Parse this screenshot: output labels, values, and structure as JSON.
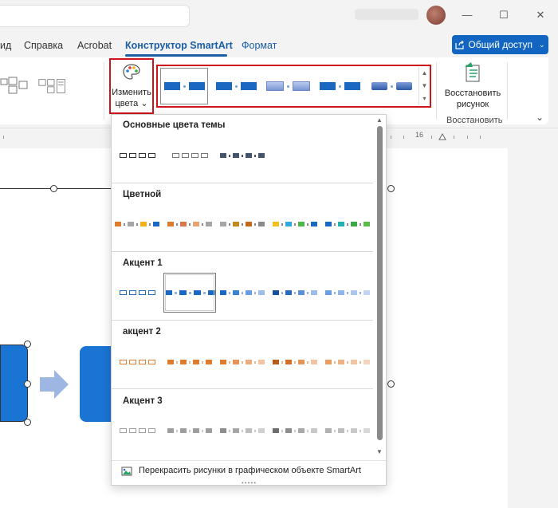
{
  "titlebar": {
    "controls": [
      "—",
      "☐",
      "✕"
    ]
  },
  "tabs": [
    {
      "label": "ид"
    },
    {
      "label": "Справка"
    },
    {
      "label": "Acrobat"
    },
    {
      "label": "Конструктор SmartArt",
      "active": true
    },
    {
      "label": "Формат"
    }
  ],
  "share_button": {
    "label": "Общий доступ",
    "chevron": "⌄"
  },
  "ribbon": {
    "change_colors": {
      "line1": "Изменить",
      "line2": "цвета ⌄",
      "icon": "palette-icon"
    },
    "restore": {
      "line1": "Восстановить",
      "line2": "рисунок",
      "group": "Восстановить",
      "icon": "reset-graphic-icon"
    },
    "collapse": "⌄"
  },
  "ruler": {
    "label_16": "16"
  },
  "dropdown": {
    "sections": [
      {
        "title": "Основные цвета темы"
      },
      {
        "title": "Цветной"
      },
      {
        "title": "Акцент 1"
      },
      {
        "title": "акцент 2"
      },
      {
        "title": "Акцент 3"
      }
    ],
    "recolor_label": "Перекрасить рисунки в графическом объекте SmartArt",
    "grip": "•••••"
  },
  "colors": {
    "accent": "#1b5ea8",
    "highlight": "#d0141c",
    "accent1": "#1a68c1",
    "accent2": "#e07b2e",
    "accent3": "#9e9e9e"
  }
}
